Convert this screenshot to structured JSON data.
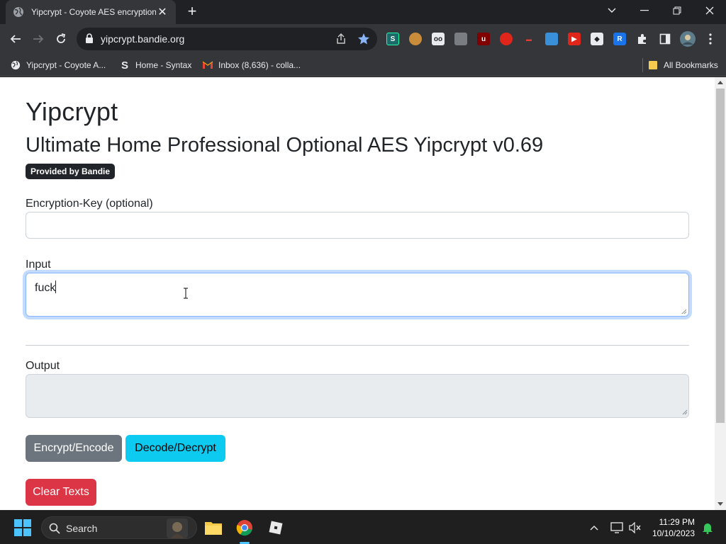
{
  "browser": {
    "tab_title": "Yipcrypt - Coyote AES encryption",
    "tab_close": "✕",
    "new_tab": "+",
    "url": "yipcrypt.bandie.org",
    "bookmarks": [
      {
        "label": "Yipcrypt - Coyote A..."
      },
      {
        "label": "Home - Syntax"
      },
      {
        "label": "Inbox (8,636) - colla..."
      }
    ],
    "all_bookmarks": "All Bookmarks"
  },
  "page": {
    "title": "Yipcrypt",
    "subtitle": "Ultimate Home Professional Optional AES Yipcrypt v0.69",
    "badge": "Provided by Bandie",
    "key_label": "Encryption-Key (optional)",
    "key_value": "",
    "input_label": "Input",
    "input_value": "fuck",
    "output_label": "Output",
    "output_value": "",
    "encrypt_label": "Encrypt/Encode",
    "decrypt_label": "Decode/Decrypt",
    "clear_label": "Clear Texts"
  },
  "colors": {
    "secondary": "#6c757d",
    "info": "#0dcaf0",
    "danger": "#dc3545",
    "focus": "#86b7fe"
  },
  "taskbar": {
    "search_label": "Search",
    "time": "11:29 PM",
    "date": "10/10/2023"
  }
}
